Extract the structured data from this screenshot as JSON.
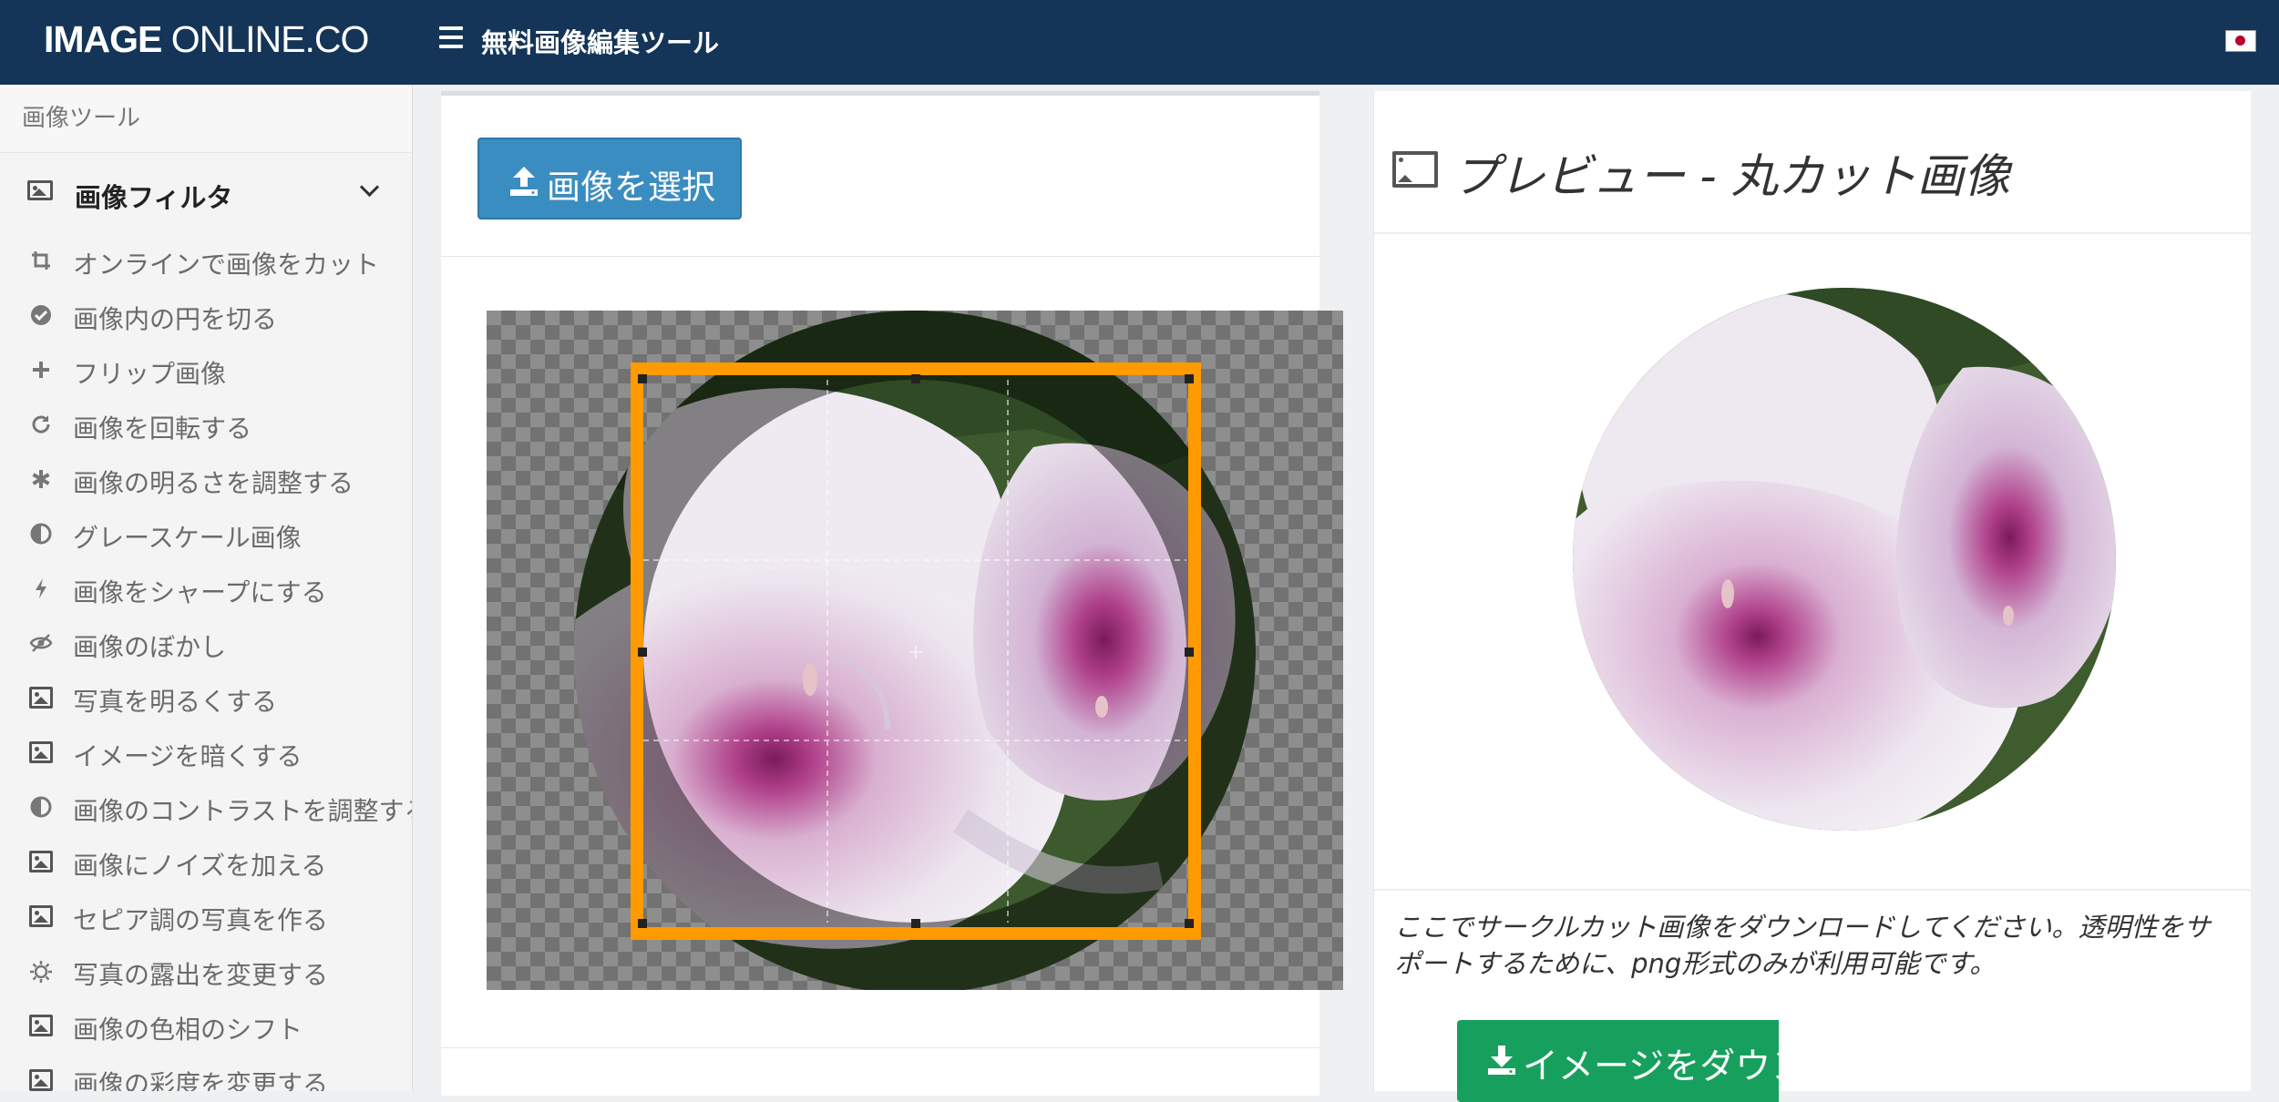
{
  "navbar": {
    "brand_bold": "IMAGE",
    "brand_light": " ONLINE.CO",
    "title": "無料画像編集ツール",
    "language_flag_icon": "japan-flag-icon",
    "colors": {
      "background": "#143557",
      "text": "#ffffff"
    }
  },
  "sidebar": {
    "header": "画像ツール",
    "group": {
      "label": "画像フィルタ",
      "icon": "image-icon",
      "expanded": true
    },
    "items": [
      {
        "label": "オンラインで画像をカット",
        "icon": "crop-icon"
      },
      {
        "label": "画像内の円を切る",
        "icon": "check-circle-icon"
      },
      {
        "label": "フリップ画像",
        "icon": "plus-icon"
      },
      {
        "label": "画像を回転する",
        "icon": "rotate-icon"
      },
      {
        "label": "画像の明るさを調整する",
        "icon": "asterisk-icon"
      },
      {
        "label": "グレースケール画像",
        "icon": "half-circle-icon"
      },
      {
        "label": "画像をシャープにする",
        "icon": "bolt-icon"
      },
      {
        "label": "画像のぼかし",
        "icon": "eye-slash-icon"
      },
      {
        "label": "写真を明るくする",
        "icon": "image-icon"
      },
      {
        "label": "イメージを暗くする",
        "icon": "image-icon"
      },
      {
        "label": "画像のコントラストを調整する",
        "icon": "half-circle-icon"
      },
      {
        "label": "画像にノイズを加える",
        "icon": "image-icon"
      },
      {
        "label": "セピア調の写真を作る",
        "icon": "image-icon"
      },
      {
        "label": "写真の露出を変更する",
        "icon": "sun-icon"
      },
      {
        "label": "画像の色相のシフト",
        "icon": "image-icon"
      },
      {
        "label": "画像の彩度を変更する",
        "icon": "image-icon"
      }
    ]
  },
  "editor": {
    "upload_label": "画像を選択",
    "upload_icon": "upload-icon",
    "crop_box_color": "#ff9a00"
  },
  "preview": {
    "title": "プレビュー - 丸カット画像",
    "title_icon": "image-icon",
    "description": "ここでサークルカット画像をダウンロードしてください。透明性をサポートするために、png形式のみが利用可能です。",
    "download_label": "イメージをダウンロード",
    "download_icon": "download-icon",
    "download_color": "#17a05d"
  }
}
